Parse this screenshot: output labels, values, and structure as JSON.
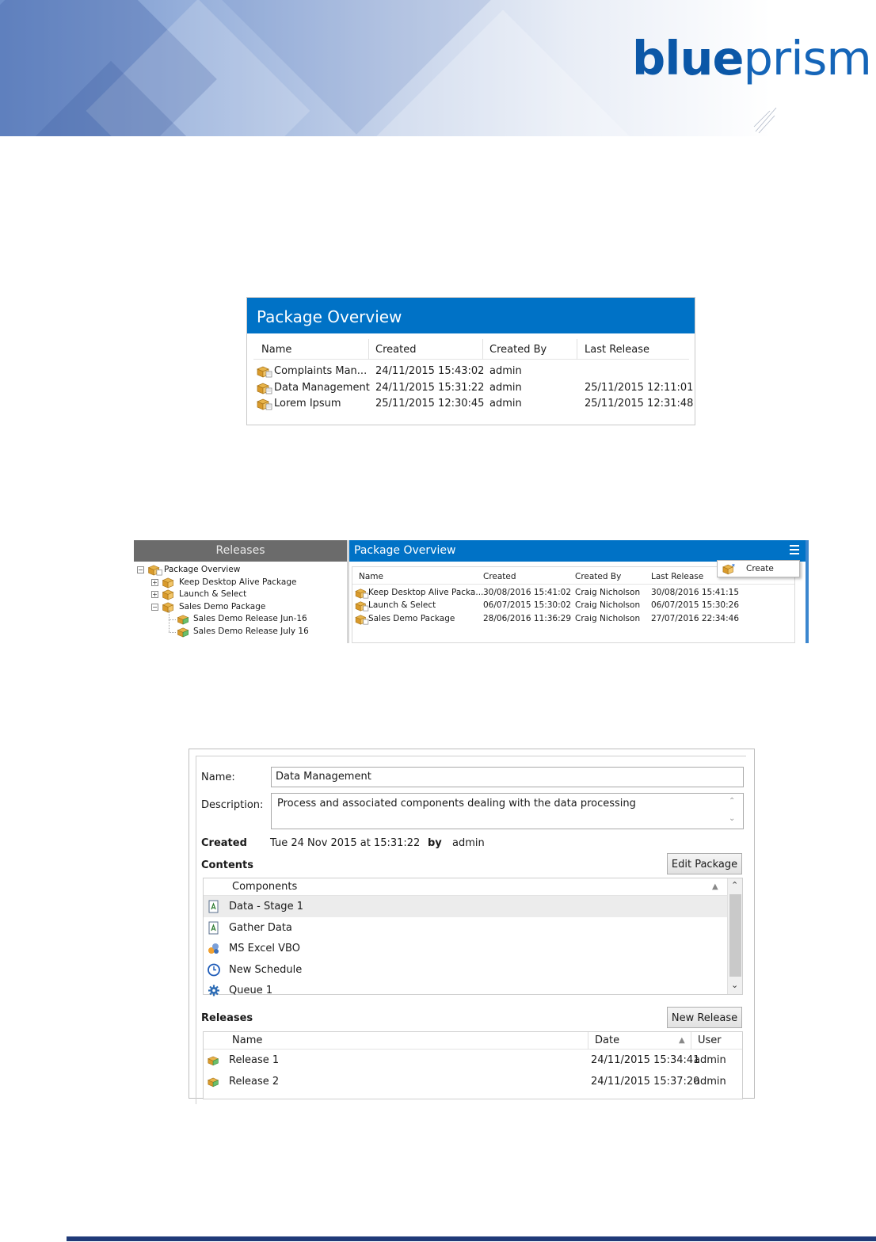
{
  "brand": {
    "logo_part1": "blue",
    "logo_part2": "prism",
    "colors": {
      "primary": "#0b57a7",
      "header_blue": "#0072c6",
      "footer": "#1f3a78"
    }
  },
  "shot1": {
    "title": "Package Overview",
    "columns": [
      "Name",
      "Created",
      "Created By",
      "Last Release"
    ],
    "rows": [
      {
        "name": "Complaints Man...",
        "created": "24/11/2015 15:43:02",
        "created_by": "admin",
        "last_release": ""
      },
      {
        "name": "Data Management",
        "created": "24/11/2015 15:31:22",
        "created_by": "admin",
        "last_release": "25/11/2015 12:11:01"
      },
      {
        "name": "Lorem Ipsum",
        "created": "25/11/2015 12:30:45",
        "created_by": "admin",
        "last_release": "25/11/2015 12:31:48"
      }
    ]
  },
  "shot2": {
    "releases_title": "Releases",
    "panel_title": "Package Overview",
    "tree": [
      {
        "label": "Package Overview",
        "level": 0,
        "expander": "−"
      },
      {
        "label": "Keep Desktop Alive Package",
        "level": 1,
        "expander": "+"
      },
      {
        "label": "Launch & Select",
        "level": 1,
        "expander": "+"
      },
      {
        "label": "Sales Demo Package",
        "level": 1,
        "expander": "−"
      },
      {
        "label": "Sales Demo Release Jun-16",
        "level": 2,
        "expander": ""
      },
      {
        "label": "Sales Demo Release July 16",
        "level": 2,
        "expander": ""
      }
    ],
    "columns": [
      "Name",
      "Created",
      "Created By",
      "Last Release"
    ],
    "rows": [
      {
        "name": "Keep Desktop Alive Packa...",
        "created": "30/08/2016 15:41:02",
        "created_by": "Craig Nicholson",
        "last_release": "30/08/2016 15:41:15"
      },
      {
        "name": "Launch & Select",
        "created": "06/07/2015 15:30:02",
        "created_by": "Craig Nicholson",
        "last_release": "06/07/2015 15:30:26"
      },
      {
        "name": "Sales Demo Package",
        "created": "28/06/2016 11:36:29",
        "created_by": "Craig Nicholson",
        "last_release": "27/07/2016 22:34:46"
      }
    ],
    "context_menu": {
      "create": "Create"
    }
  },
  "shot3": {
    "name_label": "Name:",
    "name_value": "Data Management",
    "description_label": "Description:",
    "description_value": "Process and associated components dealing with the data processing",
    "created_label": "Created",
    "created_value": "Tue 24 Nov 2015 at 15:31:22",
    "by_label": "by",
    "by_value": "admin",
    "contents_label": "Contents",
    "edit_package_button": "Edit Package",
    "components_header": "Components",
    "components": [
      {
        "label": "Data - Stage 1",
        "icon": "process-icon",
        "selected": true
      },
      {
        "label": "Gather Data",
        "icon": "process-icon",
        "selected": false
      },
      {
        "label": "MS Excel VBO",
        "icon": "business-object-icon",
        "selected": false
      },
      {
        "label": "New Schedule",
        "icon": "clock-icon",
        "selected": false
      },
      {
        "label": "Queue 1",
        "icon": "gear-icon",
        "selected": false
      }
    ],
    "releases_label": "Releases",
    "new_release_button": "New Release",
    "releases_columns": [
      "Name",
      "Date",
      "User"
    ],
    "releases": [
      {
        "name": "Release 1",
        "date": "24/11/2015 15:34:41",
        "user": "admin"
      },
      {
        "name": "Release 2",
        "date": "24/11/2015 15:37:20",
        "user": "admin"
      }
    ]
  }
}
